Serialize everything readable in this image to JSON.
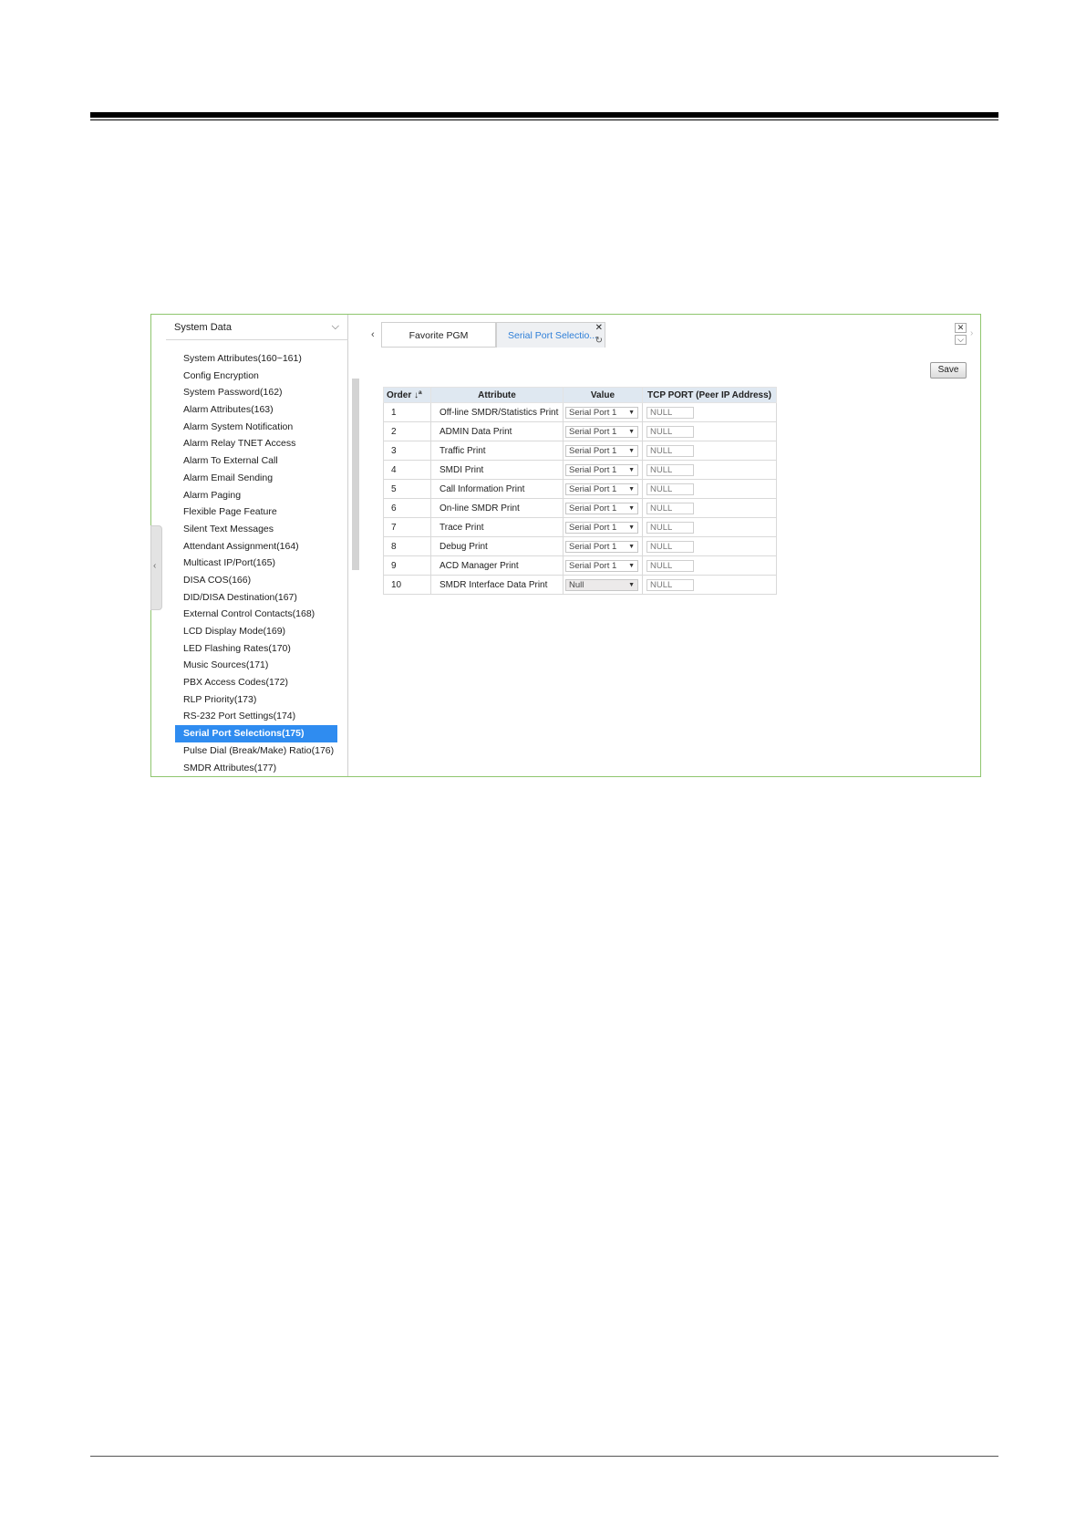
{
  "sidebar": {
    "header": "System Data",
    "items": [
      "System Attributes(160~161)",
      "Config Encryption",
      "System Password(162)",
      "Alarm Attributes(163)",
      "Alarm System Notification",
      "Alarm Relay TNET Access",
      "Alarm To External Call",
      "Alarm Email Sending",
      "Alarm Paging",
      "Flexible Page Feature",
      "Silent Text Messages",
      "Attendant Assignment(164)",
      "Multicast IP/Port(165)",
      "DISA COS(166)",
      "DID/DISA Destination(167)",
      "External Control Contacts(168)",
      "LCD Display Mode(169)",
      "LED Flashing Rates(170)",
      "Music Sources(171)",
      "PBX Access Codes(172)",
      "RLP Priority(173)",
      "RS-232 Port Settings(174)",
      "Serial Port Selections(175)",
      "Pulse Dial (Break/Make) Ratio(176)",
      "SMDR Attributes(177)"
    ],
    "selected_index": 22
  },
  "tabs": {
    "favorite": "Favorite PGM",
    "active": "Serial Port Selectio..."
  },
  "toolbar": {
    "save_label": "Save"
  },
  "table": {
    "headers": {
      "order": "Order",
      "sort_glyph": "↓ª",
      "attribute": "Attribute",
      "value": "Value",
      "tcp": "TCP PORT (Peer IP Address)"
    },
    "rows": [
      {
        "order": "1",
        "attribute": "Off-line SMDR/Statistics Print",
        "value": "Serial Port 1",
        "tcp": "NULL"
      },
      {
        "order": "2",
        "attribute": "ADMIN Data Print",
        "value": "Serial Port 1",
        "tcp": "NULL"
      },
      {
        "order": "3",
        "attribute": "Traffic Print",
        "value": "Serial Port 1",
        "tcp": "NULL"
      },
      {
        "order": "4",
        "attribute": "SMDI Print",
        "value": "Serial Port 1",
        "tcp": "NULL"
      },
      {
        "order": "5",
        "attribute": "Call Information Print",
        "value": "Serial Port 1",
        "tcp": "NULL"
      },
      {
        "order": "6",
        "attribute": "On-line SMDR Print",
        "value": "Serial Port 1",
        "tcp": "NULL"
      },
      {
        "order": "7",
        "attribute": "Trace Print",
        "value": "Serial Port 1",
        "tcp": "NULL"
      },
      {
        "order": "8",
        "attribute": "Debug Print",
        "value": "Serial Port 1",
        "tcp": "NULL"
      },
      {
        "order": "9",
        "attribute": "ACD Manager Print",
        "value": "Serial Port 1",
        "tcp": "NULL"
      },
      {
        "order": "10",
        "attribute": "SMDR Interface Data Print",
        "value": "Null",
        "tcp": "NULL"
      }
    ]
  },
  "colors": {
    "frame_border": "#8fc66e",
    "selected_item": "#2f8cf0",
    "header_bg": "#dfe8f1",
    "active_tab_text": "#2f7fd8"
  }
}
